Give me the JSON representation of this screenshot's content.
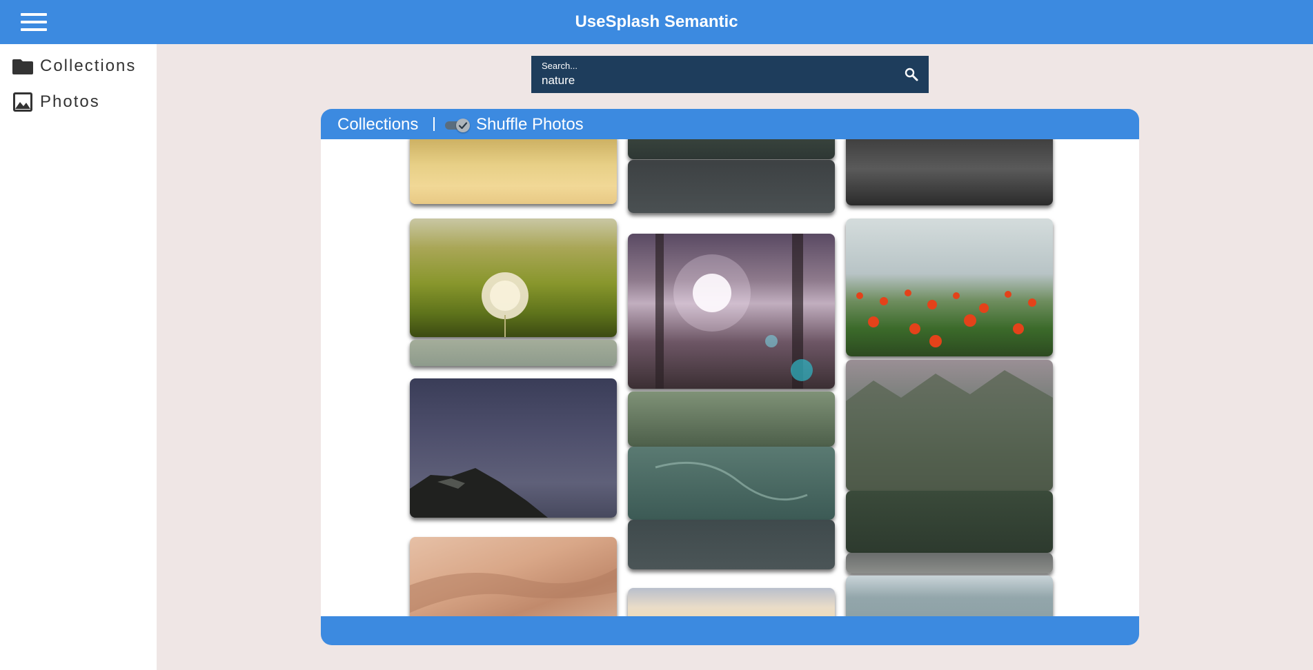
{
  "app": {
    "title": "UseSplash Semantic"
  },
  "sidebar": {
    "items": [
      {
        "label": "Collections",
        "icon": "folder-icon"
      },
      {
        "label": "Photos",
        "icon": "image-icon"
      }
    ]
  },
  "search": {
    "placeholder": "Search...",
    "value": "nature",
    "icon": "search-icon"
  },
  "panel": {
    "title": "Collections",
    "toggle_label": "Shuffle Photos",
    "toggle_on": true
  },
  "colors": {
    "accent": "#3c8ae0",
    "search_bg": "#1e3d5c",
    "page_bg": "#efe6e5"
  }
}
